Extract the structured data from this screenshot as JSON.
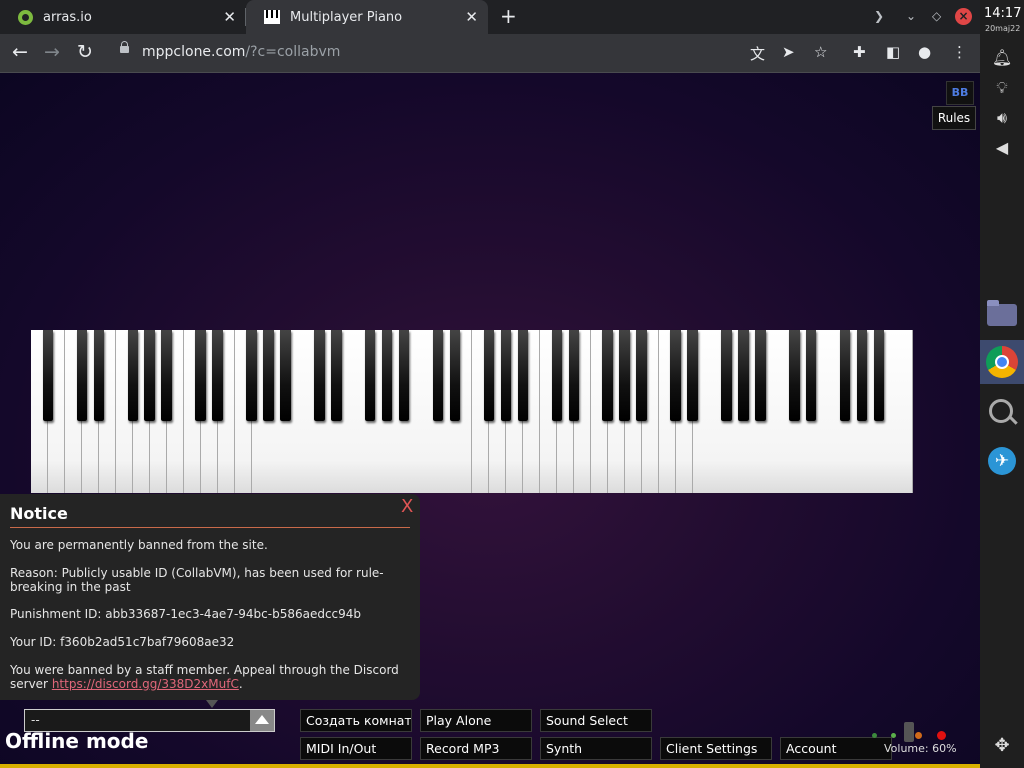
{
  "browser": {
    "tabs": [
      {
        "title": "arras.io",
        "active": false
      },
      {
        "title": "Multiplayer Piano",
        "active": true
      }
    ],
    "new_tab_icon": "plus-icon",
    "url_host": "mppclone.com",
    "url_path": "/?c=collabvm"
  },
  "system": {
    "time": "14:17",
    "date": "20maj22"
  },
  "piano_ui": {
    "top_button": "BB",
    "rules_label": "Rules",
    "notice": {
      "title": "Notice",
      "close": "X",
      "line1": "You are permanently banned from the site.",
      "line2": "Reason: Publicly usable ID (CollabVM), has been used for rule-breaking in the past",
      "line3": "Punishment ID: abb33687-1ec3-4ae7-94bc-b586aedcc94b",
      "line4": "Your ID: f360b2ad51c7baf79608ae32",
      "line5_pre": "You were banned by a staff member. Appeal through the Discord server ",
      "link": "https://discord.gg/338D2xMufC",
      "line5_post": "."
    },
    "room_select_value": "--",
    "status": "Offline mode",
    "buttons": {
      "create_room": "Создать комнату",
      "play_alone": "Play Alone",
      "sound_select": "Sound Select",
      "midi": "MIDI In/Out",
      "record": "Record MP3",
      "synth": "Synth",
      "client_settings": "Client Settings",
      "account": "Account"
    },
    "volume": "Volume: 60%"
  },
  "accent_colors": {
    "tab_bar": "#202124",
    "toolbar": "#35363a",
    "notice_bg": "#242424",
    "link": "#e0677a"
  }
}
